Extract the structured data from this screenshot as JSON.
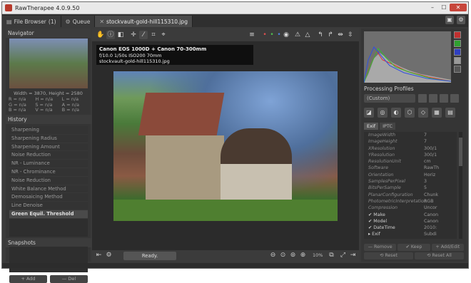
{
  "window": {
    "title": "RawTherapee 4.0.9.50",
    "controls": [
      "–",
      "☐",
      "✕"
    ]
  },
  "tabs": [
    {
      "label": "File Browser",
      "count": "(1)"
    },
    {
      "label": "Queue"
    },
    {
      "label": "stockvault-gold-hill115310.jpg"
    }
  ],
  "navigator": {
    "title": "Navigator",
    "size_text": "Width = 3870, Height = 2580",
    "values": [
      "R = n/a",
      "H = n/a",
      "L = n/a",
      "G = n/a",
      "S = n/a",
      "A = n/a",
      "B = n/a",
      "V = n/a",
      "B = n/a"
    ]
  },
  "history": {
    "title": "History",
    "items": [
      "Sharpening",
      "Sharpening Radius",
      "Sharpening Amount",
      "Noise Reduction",
      "NR - Luminance",
      "NR - Chrominance",
      "Noise Reduction",
      "White Balance Method",
      "Demosaicing Method",
      "Line Denoise",
      "Green Equil. Threshold"
    ]
  },
  "snapshots": {
    "title": "Snapshots",
    "add": "+ Add",
    "del": "— Del"
  },
  "image_info": {
    "camera": "Canon EOS 1000D + Canon 70-300mm",
    "exposure": "f/10.0  1/50s  ISO200  70mm",
    "filename": "stockvault-gold-hill115310.jpg"
  },
  "status": {
    "ready": "Ready.",
    "zoom": "10%"
  },
  "processing_profiles": {
    "title": "Processing Profiles",
    "selected": "(Custom)"
  },
  "exif_tabs": [
    "Exif",
    "IPTC"
  ],
  "exif": [
    {
      "key": "ImageWidth",
      "value": "7"
    },
    {
      "key": "ImageHeight",
      "value": "7"
    },
    {
      "key": "XResolution",
      "value": "300/1"
    },
    {
      "key": "YResolution",
      "value": "300/1"
    },
    {
      "key": "ResolutionUnit",
      "value": "cm"
    },
    {
      "key": "Software",
      "value": "RawTh"
    },
    {
      "key": "Orientation",
      "value": "Horiz"
    },
    {
      "key": "SamplesPerPixel",
      "value": "3"
    },
    {
      "key": "BitsPerSample",
      "value": "5"
    },
    {
      "key": "PlanarConfiguration",
      "value": "Chunk"
    },
    {
      "key": "PhotometricInterpretation",
      "value": "RGB"
    },
    {
      "key": "Compression",
      "value": "Uncor"
    },
    {
      "key": "✔ Make",
      "value": "Canon"
    },
    {
      "key": "✔ Model",
      "value": "Canon"
    },
    {
      "key": "✔ DateTime",
      "value": "2010:"
    },
    {
      "key": "▸ Exif",
      "value": "Subdi"
    }
  ],
  "exif_buttons": {
    "remove": "— Remove",
    "keep": "✔ Keep",
    "addedit": "+ Add/Edit",
    "reset": "⟲ Reset",
    "resetall": "⟲ Reset All"
  }
}
